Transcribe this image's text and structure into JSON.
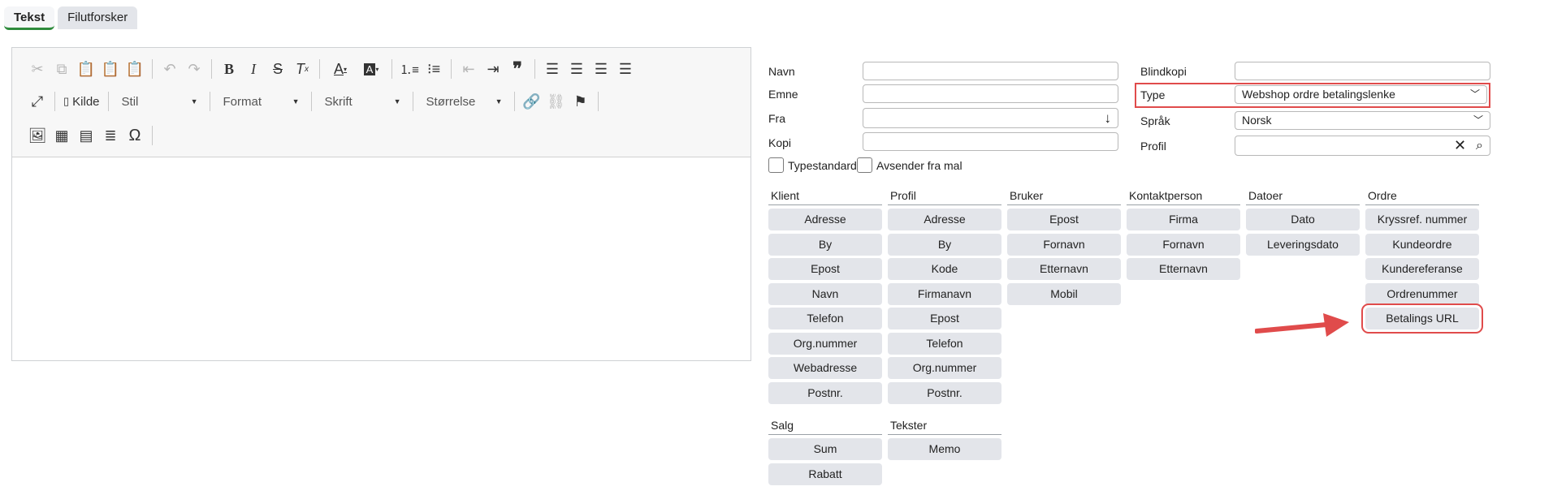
{
  "tabs": [
    {
      "label": "Tekst",
      "active": true
    },
    {
      "label": "Filutforsker",
      "active": false
    }
  ],
  "toolbar": {
    "source_label": "Kilde",
    "combos": [
      "Stil",
      "Format",
      "Skrift",
      "Størrelse"
    ]
  },
  "form": {
    "navn_label": "Navn",
    "emne_label": "Emne",
    "fra_label": "Fra",
    "kopi_label": "Kopi",
    "blindkopi_label": "Blindkopi",
    "type_label": "Type",
    "type_value": "Webshop ordre betalingslenke",
    "sprak_label": "Språk",
    "sprak_value": "Norsk",
    "profil_label": "Profil",
    "typestandard_label": "Typestandard",
    "avsender_label": "Avsender fra mal"
  },
  "columns": [
    {
      "title": "Klient",
      "items": [
        "Adresse",
        "By",
        "Epost",
        "Navn",
        "Telefon",
        "Org.nummer",
        "Webadresse",
        "Postnr."
      ]
    },
    {
      "title": "Profil",
      "items": [
        "Adresse",
        "By",
        "Kode",
        "Firmanavn",
        "Epost",
        "Telefon",
        "Org.nummer",
        "Postnr."
      ]
    },
    {
      "title": "Bruker",
      "items": [
        "Epost",
        "Fornavn",
        "Etternavn",
        "Mobil"
      ]
    },
    {
      "title": "Kontaktperson",
      "items": [
        "Firma",
        "Fornavn",
        "Etternavn"
      ]
    },
    {
      "title": "Datoer",
      "items": [
        "Dato",
        "Leveringsdato"
      ]
    },
    {
      "title": "Ordre",
      "items": [
        "Kryssref. nummer",
        "Kundeordre",
        "Kundereferanse",
        "Ordrenummer",
        "Betalings URL"
      ]
    },
    {
      "title": "Salg",
      "items": [
        "Sum",
        "Rabatt"
      ]
    },
    {
      "title": "Tekster",
      "items": [
        "Memo"
      ]
    }
  ],
  "colors": {
    "highlight": "#e04b4b",
    "tab_accent": "#2e8b3c"
  }
}
